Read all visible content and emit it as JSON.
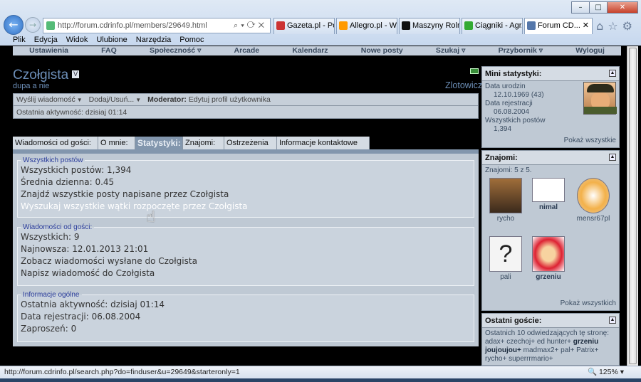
{
  "browser": {
    "url": "http://forum.cdrinfo.pl/members/29649.html",
    "tabs": [
      {
        "label": "Gazeta.pl - Po..."
      },
      {
        "label": "Allegro.pl - W..."
      },
      {
        "label": "Maszyny Roln..."
      },
      {
        "label": "Ciągniki - Agr..."
      },
      {
        "label": "Forum CD..."
      }
    ],
    "menu": [
      "Plik",
      "Edycja",
      "Widok",
      "Ulubione",
      "Narzędzia",
      "Pomoc"
    ],
    "status_url": "http://forum.cdrinfo.pl/search.php?do=finduser&u=29649&starteronly=1",
    "zoom": "125%"
  },
  "sitenav": [
    "Ustawienia",
    "FAQ",
    "Społeczność",
    "Arcade",
    "Kalendarz",
    "Nowe posty",
    "Szukaj",
    "Przybornik",
    "Wyloguj"
  ],
  "profile": {
    "username": "Czołgista",
    "badge": "V",
    "usertitle": "dupa a nie",
    "location": "Zlotowicz",
    "actions": {
      "send_message": "Wyślij wiadomość",
      "add_remove": "Dodaj/Usuń...",
      "moderator_label": "Moderator:",
      "moderator_action": "Edytuj profil użytkownika"
    },
    "last_activity": "Ostatnia aktywność: dzisiaj 01:14"
  },
  "ptabs": [
    "Wiadomości od gości:",
    "O mnie:",
    "Statystyki:",
    "Znajomi:",
    "Ostrzeżenia",
    "Informacje kontaktowe"
  ],
  "stats": {
    "posts": {
      "legend": "Wszystkich postów",
      "rows": [
        "Wszystkich postów: 1,394",
        "Średnia dzienna: 0.45",
        "Znajdź wszystkie posty napisane przez Czołgista",
        "Wyszukaj wszystkie wątki rozpoczęte przez Czołgista"
      ]
    },
    "visitor_messages": {
      "legend": "Wiadomości od gości:",
      "rows": [
        "Wszystkich: 9",
        "Najnowsza: 12.01.2013 21:01",
        "Zobacz wiadomości wysłane do Czołgista",
        "Napisz wiadomość do Czołgista"
      ]
    },
    "general": {
      "legend": "Informacje ogólne",
      "rows": [
        "Ostatnia aktywność: dzisiaj 01:14",
        "Data rejestracji: 06.08.2004",
        "Zaproszeń: 0"
      ]
    }
  },
  "mini_stats": {
    "title": "Mini statystyki:",
    "birth_label": "Data urodzin",
    "birth_value": "12.10.1969 (43)",
    "reg_label": "Data rejestracji",
    "reg_value": "06.08.2004",
    "posts_label": "Wszystkich postów",
    "posts_value": "1,394",
    "show_all": "Pokaż wszystkie"
  },
  "friends": {
    "title": "Znajomi:",
    "count": "Znajomi: 5 z 5.",
    "list": [
      {
        "name": "rycho"
      },
      {
        "name": "nimal"
      },
      {
        "name": "mensr67pl"
      },
      {
        "name": "pali"
      },
      {
        "name": "grzeniu"
      }
    ],
    "show_all": "Pokaż wszystkich"
  },
  "guests": {
    "title": "Ostatni goście:",
    "intro": "Ostatnich 10 odwiedzających tę stronę:",
    "line1": "adax+ czechoj+ ed hunter+",
    "line1_bold": "grzeniu",
    "line2_bold": "joujoujou+",
    "line2": "madmax2+ pal+ Patrix+",
    "line3": "rycho+ superrrmario+"
  }
}
